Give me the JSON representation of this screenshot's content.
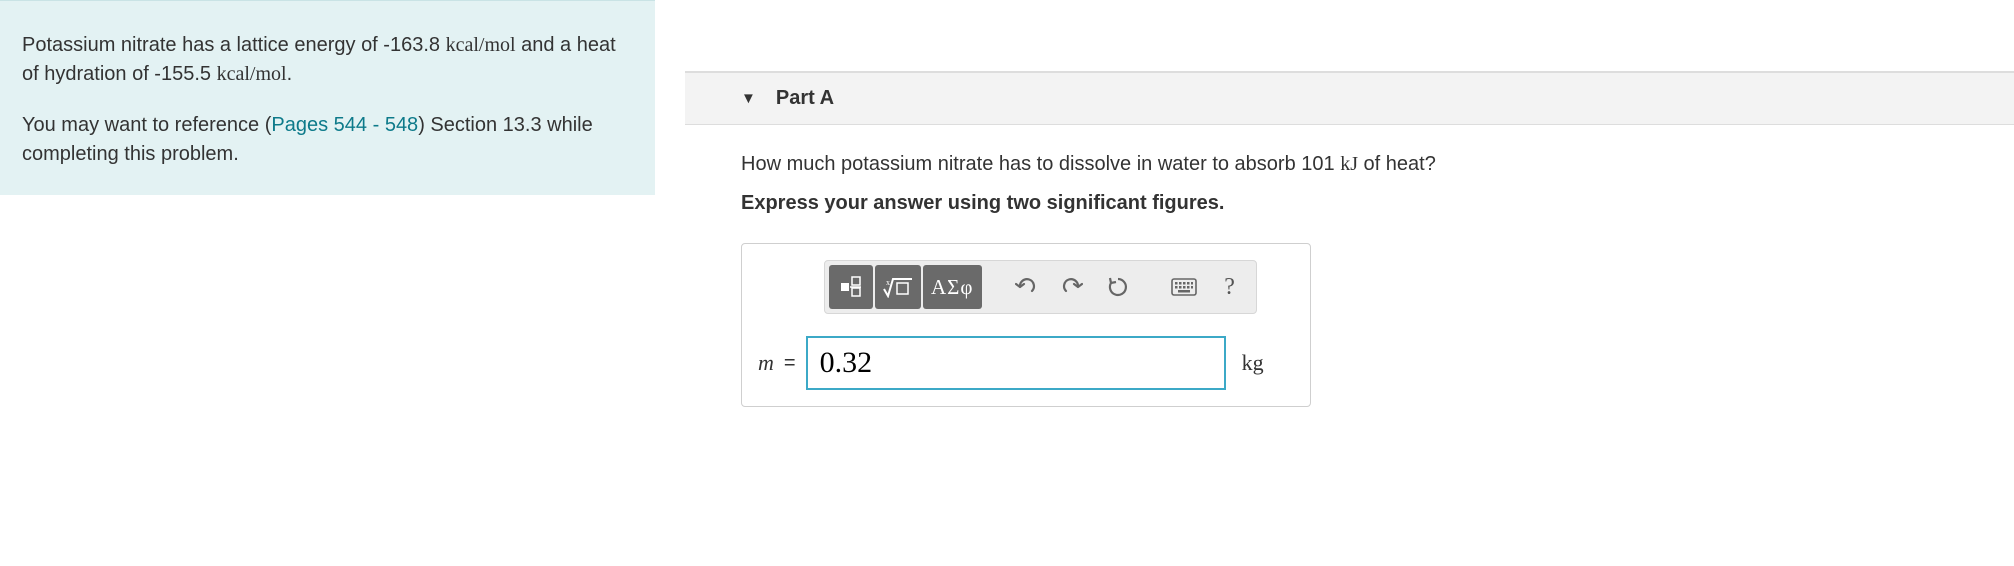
{
  "info": {
    "paragraph1_pre": "Potassium nitrate has a lattice energy of -163.8 ",
    "unit1": "kcal/mol",
    "paragraph1_mid": " and a heat of hydration of -155.5 ",
    "unit2": "kcal/mol",
    "paragraph1_post": ".",
    "paragraph2_pre": "You may want to reference (",
    "pages_link": "Pages 544 - 548",
    "paragraph2_post": ") Section 13.3 while completing this problem."
  },
  "part": {
    "title": "Part A",
    "question_pre": "How much potassium nitrate has to dissolve in water to absorb 101 ",
    "question_unit": "kJ",
    "question_post": " of heat?",
    "instruction": "Express your answer using two significant figures.",
    "variable": "m",
    "equals": "=",
    "value": "0.32",
    "unit": "kg"
  },
  "toolbar": {
    "templates": "templates-icon",
    "sqrt": "sqrt-icon",
    "greek": "ΑΣφ",
    "undo": "undo-icon",
    "redo": "redo-icon",
    "reset": "reset-icon",
    "keyboard": "keyboard-icon",
    "help": "?"
  }
}
